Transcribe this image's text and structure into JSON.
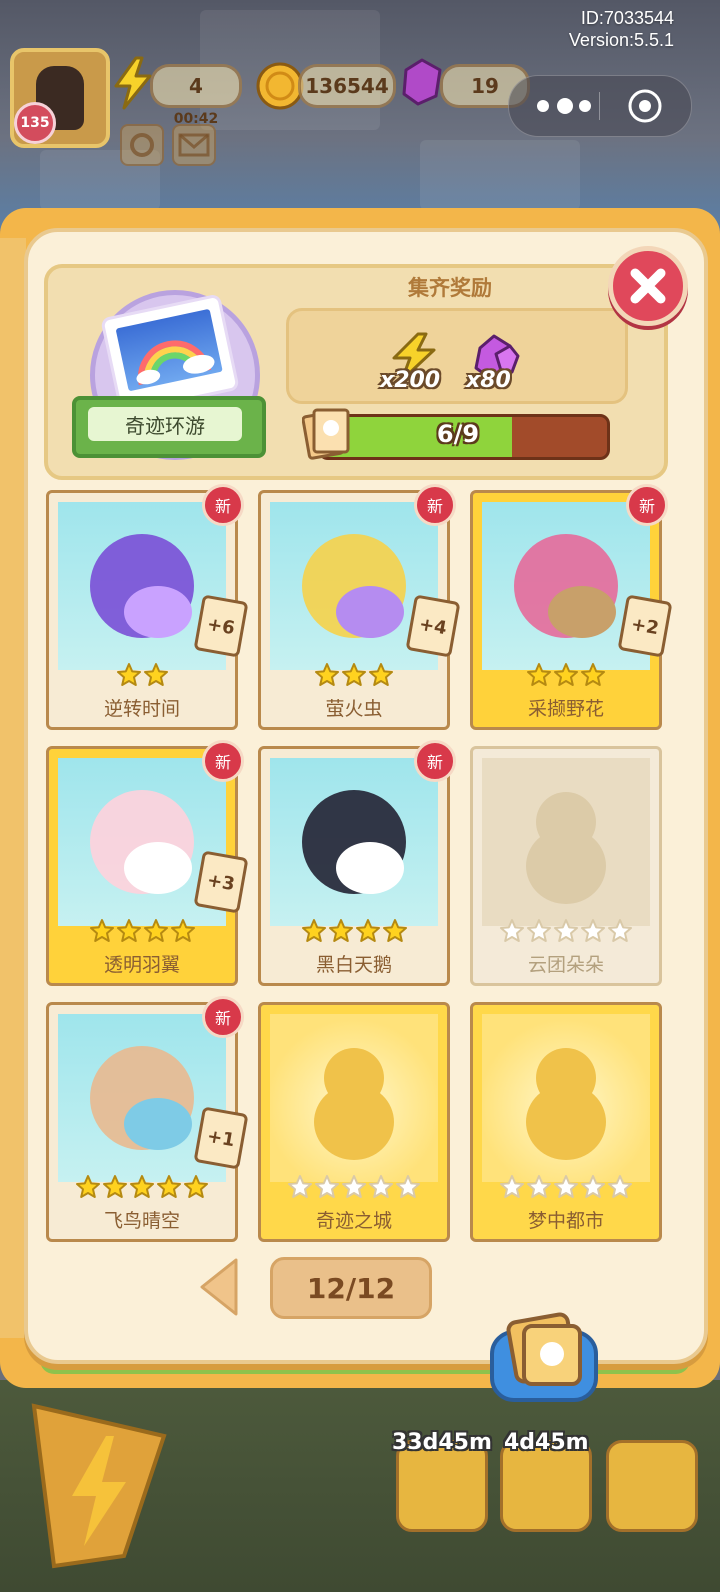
{
  "system": {
    "id_text": "ID:7033544",
    "version_text": "Version:5.5.1"
  },
  "hud": {
    "level": "135",
    "energy": "4",
    "energy_timer": "00:42",
    "coins": "136544",
    "gems": "19"
  },
  "album": {
    "set_name": "奇迹环游",
    "reward_title": "集齐奖励",
    "rewards": [
      {
        "icon": "lightning-icon",
        "qty": "x200"
      },
      {
        "icon": "gem-icon",
        "qty": "x80"
      }
    ],
    "progress_text": "6/9",
    "progress_fraction": 0.667,
    "new_badge_text": "新",
    "page_indicator": "12/12",
    "cards": [
      {
        "name": "逆转时间",
        "stars": 2,
        "owned": true,
        "is_new": true,
        "duplicates": "+6",
        "gold": false
      },
      {
        "name": "萤火虫",
        "stars": 3,
        "owned": true,
        "is_new": true,
        "duplicates": "+4",
        "gold": false
      },
      {
        "name": "采撷野花",
        "stars": 3,
        "owned": true,
        "is_new": true,
        "duplicates": "+2",
        "gold": true
      },
      {
        "name": "透明羽翼",
        "stars": 4,
        "owned": true,
        "is_new": true,
        "duplicates": "+3",
        "gold": true
      },
      {
        "name": "黑白天鹅",
        "stars": 4,
        "owned": true,
        "is_new": true,
        "duplicates": "",
        "gold": false
      },
      {
        "name": "云团朵朵",
        "stars": 5,
        "owned": false,
        "is_new": false,
        "duplicates": "",
        "gold": false
      },
      {
        "name": "飞鸟晴空",
        "stars": 5,
        "owned": true,
        "is_new": true,
        "duplicates": "+1",
        "gold": false
      },
      {
        "name": "奇迹之城",
        "stars": 5,
        "owned": false,
        "is_new": false,
        "duplicates": "",
        "gold": true
      },
      {
        "name": "梦中都市",
        "stars": 5,
        "owned": false,
        "is_new": false,
        "duplicates": "",
        "gold": true
      }
    ]
  },
  "bottom": {
    "timer1": "33d45m",
    "timer2": "4d45m"
  },
  "colors": {
    "star_filled": "#ffd21f",
    "star_empty": "#ffffff",
    "close_red": "#e0485b",
    "progress_green": "#8fd43c"
  }
}
